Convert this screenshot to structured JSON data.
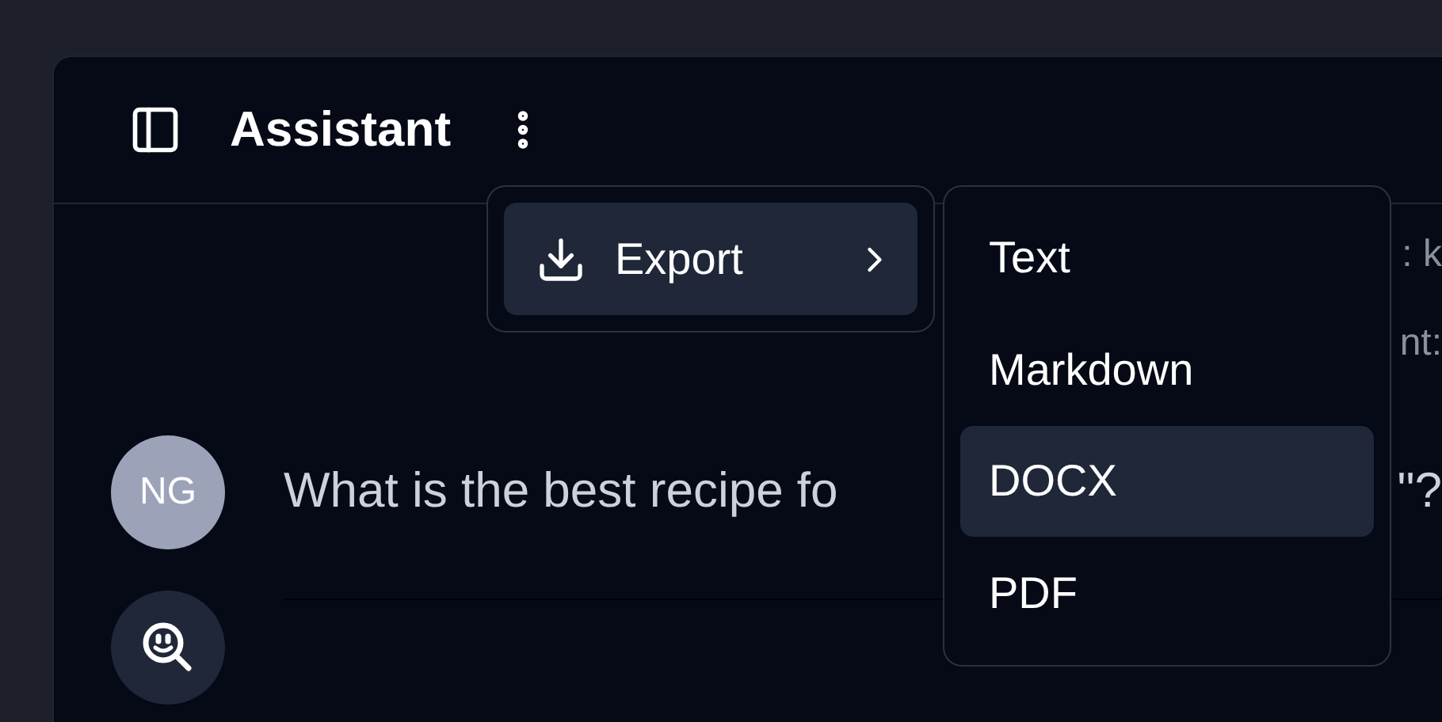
{
  "header": {
    "title": "Assistant"
  },
  "background_texts": [
    ": k",
    "nt:"
  ],
  "messages": [
    {
      "kind": "user",
      "initials": "NG",
      "text_start": "What is the best recipe fo",
      "text_end": "\"?"
    },
    {
      "kind": "assistant"
    }
  ],
  "menu": {
    "label": "Export",
    "selected": true
  },
  "submenu": [
    {
      "label": "Text",
      "selected": false
    },
    {
      "label": "Markdown",
      "selected": false
    },
    {
      "label": "DOCX",
      "selected": true
    },
    {
      "label": "PDF",
      "selected": false
    }
  ]
}
